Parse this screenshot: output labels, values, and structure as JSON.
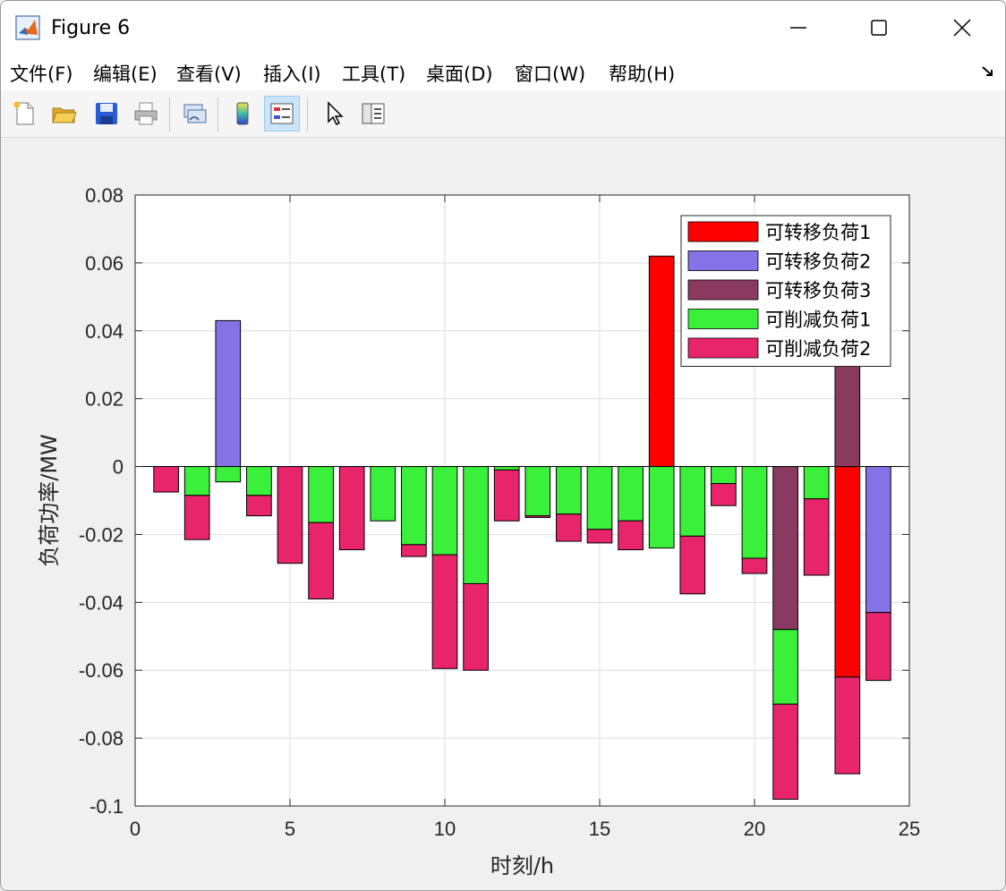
{
  "window": {
    "title": "Figure 6"
  },
  "menu": {
    "items": [
      "文件(F)",
      "编辑(E)",
      "查看(V)",
      "插入(I)",
      "工具(T)",
      "桌面(D)",
      "窗口(W)",
      "帮助(H)"
    ]
  },
  "toolbar": {
    "icons": [
      "new-figure-icon",
      "open-icon",
      "save-icon",
      "print-icon",
      "link-plot-icon",
      "colorbar-icon",
      "legend-icon",
      "pointer-icon",
      "property-inspector-icon"
    ]
  },
  "chart_data": {
    "type": "bar",
    "stacked": true,
    "xlabel": "时刻/h",
    "ylabel": "负荷功率/MW",
    "xlim": [
      0,
      25
    ],
    "ylim": [
      -0.1,
      0.08
    ],
    "xticks": [
      "0",
      "5",
      "10",
      "15",
      "20",
      "25"
    ],
    "yticks": [
      "0.08",
      "0.06",
      "0.04",
      "0.02",
      "0",
      "-0.02",
      "-0.04",
      "-0.06",
      "-0.08",
      "-0.1"
    ],
    "grid": true,
    "legend_position": "top-right",
    "x": [
      1,
      2,
      3,
      4,
      5,
      6,
      7,
      8,
      9,
      10,
      11,
      12,
      13,
      14,
      15,
      16,
      17,
      18,
      19,
      20,
      21,
      22,
      23,
      24
    ],
    "series": [
      {
        "name": "可转移负荷1",
        "color": "#ff0000",
        "values": [
          0,
          0,
          0,
          0,
          0,
          0,
          0,
          0,
          0,
          0,
          0,
          0,
          0,
          0,
          0,
          0,
          0.062,
          0,
          0,
          0,
          0,
          0,
          -0.062,
          0
        ]
      },
      {
        "name": "可转移负荷2",
        "color": "#8572e6",
        "values": [
          0,
          0,
          0.043,
          0,
          0,
          0,
          0,
          0,
          0,
          0,
          0,
          0,
          0,
          0,
          0,
          0,
          0,
          0,
          0,
          0,
          0,
          0,
          0,
          -0.043
        ]
      },
      {
        "name": "可转移负荷3",
        "color": "#8a3a5e",
        "values": [
          0,
          0,
          0,
          0,
          0,
          0,
          0,
          0,
          0,
          0,
          0,
          0,
          0,
          0,
          0,
          0,
          0,
          0,
          0,
          0,
          -0.048,
          0,
          0.048,
          0
        ]
      },
      {
        "name": "可削减负荷1",
        "color": "#3af03a",
        "values": [
          0,
          -0.0085,
          -0.0045,
          -0.0085,
          0,
          -0.0165,
          0,
          -0.016,
          -0.023,
          -0.026,
          -0.0345,
          -0.001,
          -0.0145,
          -0.014,
          -0.0185,
          -0.016,
          -0.024,
          -0.0205,
          -0.005,
          -0.027,
          -0.022,
          -0.0095,
          0,
          0
        ]
      },
      {
        "name": "可削减负荷2",
        "color": "#e8256a",
        "values": [
          -0.0075,
          -0.013,
          0,
          -0.006,
          -0.0285,
          -0.0225,
          -0.0245,
          0,
          -0.0035,
          -0.0335,
          -0.0255,
          -0.015,
          -0.0005,
          -0.008,
          -0.004,
          -0.0085,
          0,
          -0.017,
          -0.0065,
          -0.0045,
          -0.028,
          -0.0225,
          -0.0285,
          -0.02
        ]
      }
    ]
  }
}
